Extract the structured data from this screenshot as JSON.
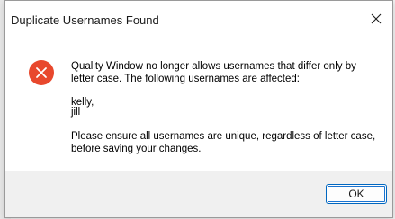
{
  "dialog": {
    "title": "Duplicate Usernames Found",
    "close_icon": "close-icon",
    "status_icon": "error-icon",
    "error_color": "#e8482d",
    "message_intro": "Quality Window no longer allows usernames that differ only by letter case. The following usernames are affected:",
    "affected_usernames": [
      "kelly,",
      "jill"
    ],
    "message_outro": "Please ensure all usernames are unique, regardless of letter case, before saving your changes.",
    "ok_label": "OK",
    "accent_color": "#0067c0"
  }
}
